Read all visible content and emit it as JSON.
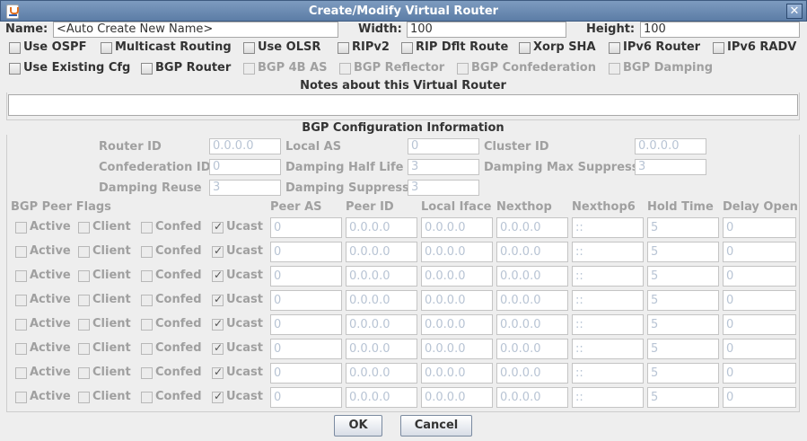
{
  "window": {
    "title": "Create/Modify Virtual Router"
  },
  "top": {
    "name_label": "Name:",
    "name_value": "<Auto Create New Name>",
    "width_label": "Width:",
    "width_value": "100",
    "height_label": "Height:",
    "height_value": "100"
  },
  "options_row1": [
    "Use OSPF",
    "Multicast Routing",
    "Use OLSR",
    "RIPv2",
    "RIP Dflt Route",
    "Xorp SHA",
    "IPv6 Router",
    "IPv6 RADV"
  ],
  "options_row2": [
    "Use Existing Cfg",
    "BGP Router",
    "BGP 4B AS",
    "BGP Reflector",
    "BGP Confederation",
    "BGP Damping"
  ],
  "notes": {
    "title": "Notes about this Virtual Router",
    "value": ""
  },
  "bgp": {
    "title": "BGP Configuration Information",
    "router_id_label": "Router ID",
    "router_id": "0.0.0.0",
    "local_as_label": "Local AS",
    "local_as": "0",
    "cluster_id_label": "Cluster ID",
    "cluster_id": "0.0.0.0",
    "confed_id_label": "Confederation ID",
    "confed_id": "0",
    "damp_half_label": "Damping Half Life",
    "damp_half": "3",
    "damp_max_label": "Damping Max Suppress",
    "damp_max": "3",
    "damp_reuse_label": "Damping Reuse",
    "damp_reuse": "3",
    "damp_supp_label": "Damping Suppress",
    "damp_supp": "3"
  },
  "peers": {
    "headers": [
      "BGP Peer Flags",
      "Peer AS",
      "Peer ID",
      "Local Iface",
      "Nexthop",
      "Nexthop6",
      "Hold Time",
      "Delay Open"
    ],
    "flag_labels": [
      "Active",
      "Client",
      "Confed",
      "Ucast"
    ],
    "row_values": [
      "0",
      "0.0.0.0",
      "0.0.0.0",
      "0.0.0.0",
      "::",
      "5",
      "0"
    ],
    "row_count": 8
  },
  "buttons": {
    "ok": "OK",
    "cancel": "Cancel"
  }
}
